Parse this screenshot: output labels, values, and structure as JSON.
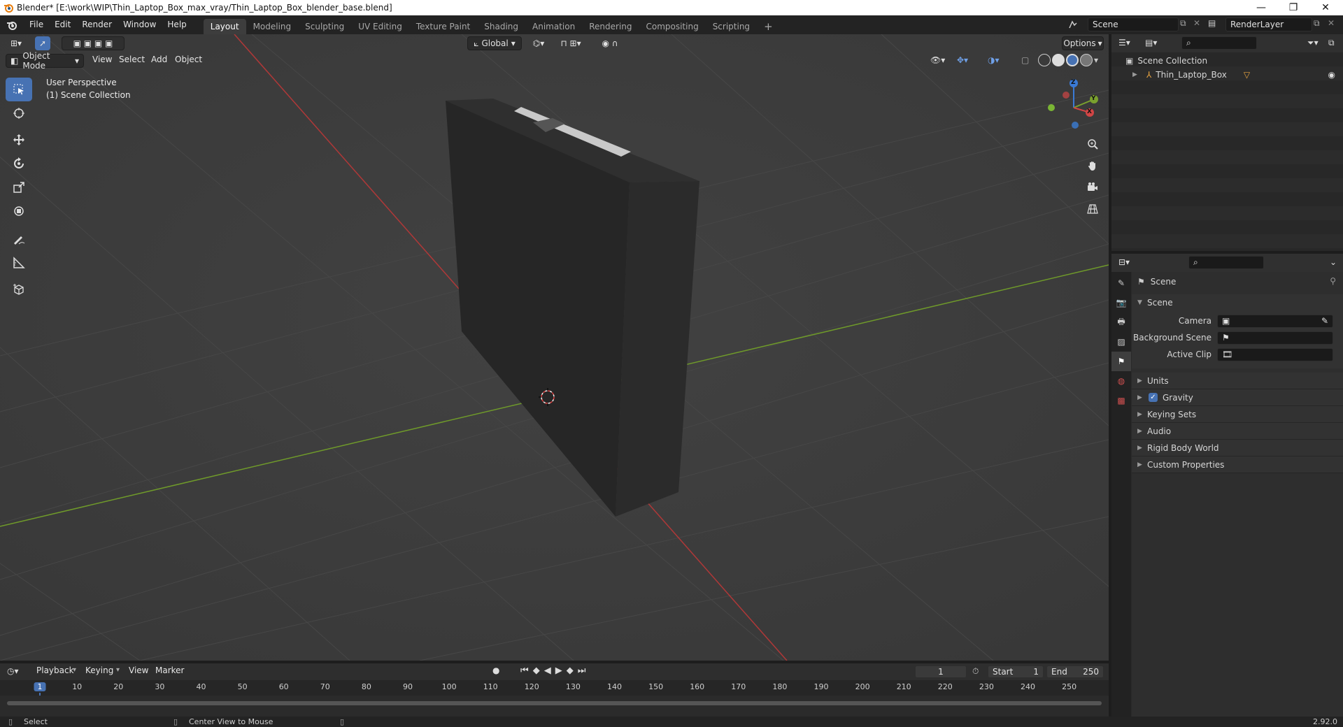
{
  "titlebar": {
    "title": "Blender* [E:\\work\\WIP\\Thin_Laptop_Box_max_vray/Thin_Laptop_Box_blender_base.blend]",
    "minimize": "—",
    "maximize": "❐",
    "close": "✕"
  },
  "menu": [
    "File",
    "Edit",
    "Render",
    "Window",
    "Help"
  ],
  "workspaces": [
    "Layout",
    "Modeling",
    "Sculpting",
    "UV Editing",
    "Texture Paint",
    "Shading",
    "Animation",
    "Rendering",
    "Compositing",
    "Scripting"
  ],
  "active_workspace": "Layout",
  "add_workspace": "+",
  "scene_field": "Scene",
  "renderlayer_field": "RenderLayer",
  "viewport": {
    "mode": "Object Mode",
    "header_menus": [
      "View",
      "Select",
      "Add",
      "Object"
    ],
    "orientation": "Global",
    "options": "Options",
    "overlay_line1": "User Perspective",
    "overlay_line2": "(1) Scene Collection",
    "gizmo": {
      "z": "Z",
      "y": "Y",
      "x": "X"
    }
  },
  "outliner": {
    "root": "Scene Collection",
    "items": [
      {
        "label": "Thin_Laptop_Box"
      }
    ]
  },
  "properties": {
    "header": "Scene",
    "section": "Scene",
    "fields": [
      {
        "label": "Camera",
        "value": ""
      },
      {
        "label": "Background Scene",
        "value": ""
      },
      {
        "label": "Active Clip",
        "value": ""
      }
    ],
    "panels": [
      "Units",
      "Gravity",
      "Keying Sets",
      "Audio",
      "Rigid Body World",
      "Custom Properties"
    ],
    "gravity_checked": true
  },
  "timeline": {
    "menus": [
      "Playback",
      "Keying",
      "View",
      "Marker"
    ],
    "current_frame": "1",
    "start_label": "Start",
    "start": "1",
    "end_label": "End",
    "end": "250",
    "ruler": [
      "1",
      "10",
      "20",
      "30",
      "40",
      "50",
      "60",
      "70",
      "80",
      "90",
      "100",
      "110",
      "120",
      "130",
      "140",
      "150",
      "160",
      "170",
      "180",
      "190",
      "200",
      "210",
      "220",
      "230",
      "240",
      "250"
    ]
  },
  "statusbar": {
    "left": "Select",
    "middle": "Center View to Mouse",
    "version": "2.92.0"
  },
  "colors": {
    "accent": "#4772b3",
    "x_axis": "#c33a3a",
    "y_axis": "#7aa12e",
    "viewport_bg": "#3b3b3b"
  }
}
